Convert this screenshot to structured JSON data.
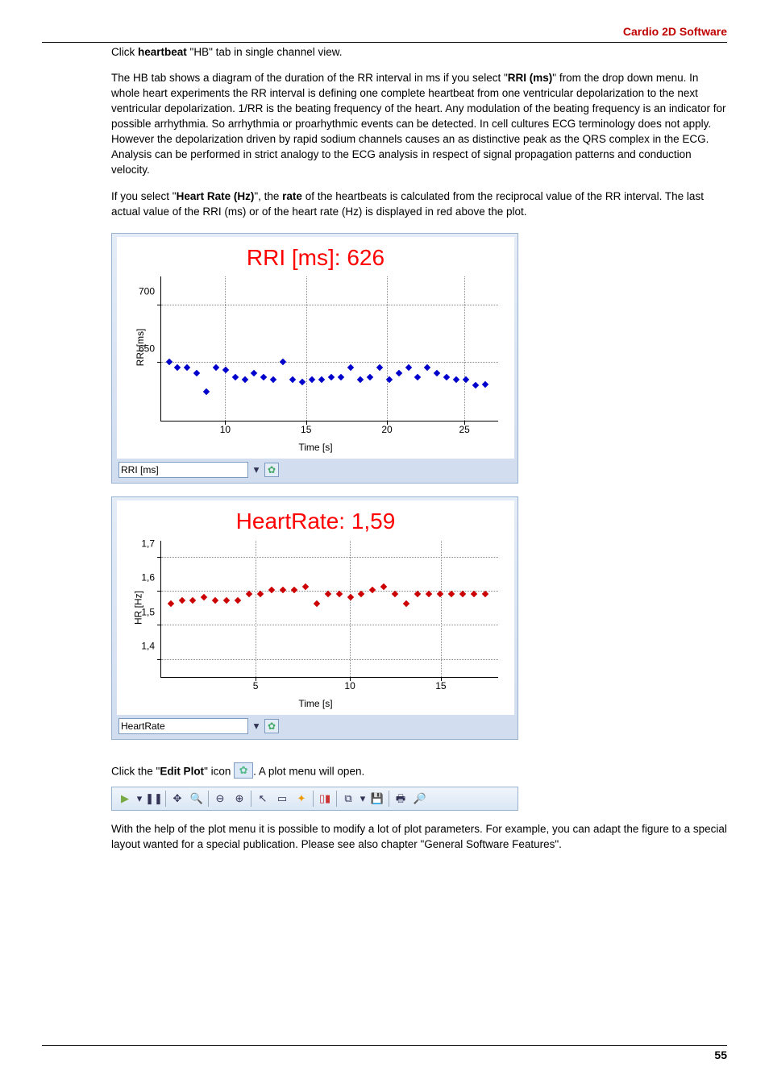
{
  "header": {
    "section_title": "Cardio 2D Software"
  },
  "page": {
    "number": "55"
  },
  "body": {
    "p1_a": "Click ",
    "p1_b": "heartbeat",
    "p1_c": " \"HB\" tab in single channel view.",
    "p2_a": "The HB tab shows a diagram of the duration of the RR interval in ms if you select \"",
    "p2_b": "RRI (ms)",
    "p2_c": "\" from the drop down menu. In whole heart experiments the RR interval is defining one complete heartbeat from one ventricular depolarization to the next ventricular depolarization. 1/RR is the beating frequency of the heart. Any modulation of the beating frequency is an indicator for possible arrhythmia. So arrhythmia or proarhythmic events can be detected. In cell cultures ECG terminology does not apply. However the depolarization driven by rapid sodium channels causes an as distinctive peak as the QRS complex in the ECG. Analysis can be performed in strict analogy to the ECG analysis in respect of signal propagation patterns and conduction velocity.",
    "p3_a": "If you select \"",
    "p3_b": "Heart Rate (Hz)",
    "p3_c": "\", the ",
    "p3_d": "rate",
    "p3_e": " of the heartbeats is calculated from the reciprocal value of the RR interval. The last actual value of the RRI (ms) or of the heart rate (Hz) is displayed in red above the plot.",
    "p4_a": "Click the \"",
    "p4_b": "Edit Plot",
    "p4_c": "\" icon ",
    "p4_d": ". A plot menu will open.",
    "p5": "With the help of the plot menu it is possible to modify a lot of plot parameters. For example, you can adapt the figure to a special layout wanted for a special publication. Please see also chapter \"General Software Features\"."
  },
  "chart1": {
    "title": "RRI [ms]: 626",
    "ylabel": "RRI [ms]",
    "xlabel": "Time [s]",
    "dropdown": "RRI [ms]",
    "yticks": [
      "700",
      "650"
    ],
    "xticks": [
      "10",
      "15",
      "20",
      "25"
    ]
  },
  "chart2": {
    "title": "HeartRate: 1,59",
    "ylabel": "HR [Hz]",
    "xlabel": "Time [s]",
    "dropdown": "HeartRate",
    "yticks": [
      "1,7",
      "1,6",
      "1,5",
      "1,4"
    ],
    "xticks": [
      "5",
      "10",
      "15"
    ]
  },
  "chart_data": [
    {
      "type": "scatter",
      "title": "RRI [ms]: 626",
      "xlabel": "Time [s]",
      "ylabel": "RRI [ms]",
      "xlim": [
        6,
        27
      ],
      "ylim": [
        600,
        720
      ],
      "x": [
        6.5,
        7,
        7.6,
        8.2,
        8.8,
        9.4,
        10,
        10.6,
        11.2,
        11.8,
        12.4,
        13,
        13.6,
        14.2,
        14.8,
        15.4,
        16,
        16.6,
        17.2,
        17.8,
        18.4,
        19,
        19.6,
        20.2,
        20.8,
        21.4,
        22,
        22.6,
        23.2,
        23.8,
        24.4,
        25,
        25.6,
        26.2
      ],
      "y": [
        645,
        640,
        640,
        635,
        620,
        640,
        638,
        632,
        630,
        635,
        632,
        630,
        645,
        630,
        628,
        630,
        630,
        632,
        632,
        640,
        630,
        632,
        640,
        630,
        635,
        640,
        632,
        640,
        635,
        632,
        630,
        630,
        625,
        626
      ]
    },
    {
      "type": "scatter",
      "title": "HeartRate: 1,59",
      "xlabel": "Time [s]",
      "ylabel": "HR [Hz]",
      "xlim": [
        0,
        18
      ],
      "ylim": [
        1.35,
        1.75
      ],
      "x": [
        0.5,
        1.1,
        1.7,
        2.3,
        2.9,
        3.5,
        4.1,
        4.7,
        5.3,
        5.9,
        6.5,
        7.1,
        7.7,
        8.3,
        8.9,
        9.5,
        10.1,
        10.7,
        11.3,
        11.9,
        12.5,
        13.1,
        13.7,
        14.3,
        14.9,
        15.5,
        16.1,
        16.7,
        17.3
      ],
      "y": [
        1.55,
        1.56,
        1.56,
        1.57,
        1.56,
        1.56,
        1.56,
        1.58,
        1.58,
        1.59,
        1.59,
        1.59,
        1.6,
        1.55,
        1.58,
        1.58,
        1.57,
        1.58,
        1.59,
        1.6,
        1.58,
        1.55,
        1.58,
        1.58,
        1.58,
        1.58,
        1.58,
        1.58,
        1.58
      ]
    }
  ],
  "toolbar": {
    "icons": [
      "play-icon",
      "dropdown-icon",
      "pause-icon",
      "move-icon",
      "zoom-tool-icon",
      "zoom-out-icon",
      "zoom-in-icon",
      "pointer-icon",
      "region-icon",
      "sparkle-icon",
      "column-chart-icon",
      "copy-icon",
      "dropdown-icon",
      "save-icon",
      "print-icon",
      "preview-icon"
    ]
  }
}
